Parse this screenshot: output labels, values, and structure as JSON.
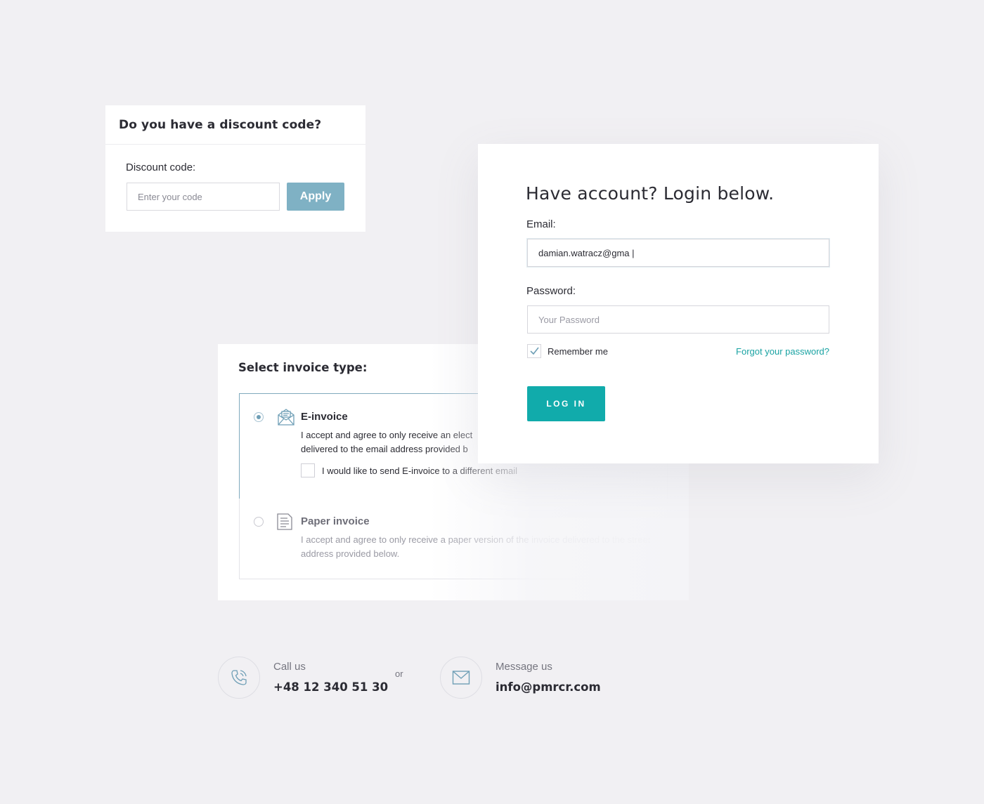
{
  "discount": {
    "title": "Do you have a discount code?",
    "label": "Discount code:",
    "placeholder": "Enter your code",
    "apply_label": "Apply"
  },
  "invoice": {
    "title": "Select invoice type:",
    "options": [
      {
        "name": "E-invoice",
        "description": "I accept and agree to only receive an elect... delivered to the email address provided b...",
        "desc_line1": "I accept and agree to only receive an elect",
        "desc_line2": "delivered to the email address provided b",
        "selected": true,
        "icon": "envelope-open-icon",
        "extra_checkbox_label": "I would like to send E-invoice to a different email"
      },
      {
        "name": "Paper invoice",
        "description": "I accept and agree to only receive a paper version of the invoice delivered to the street address provided below.",
        "selected": false,
        "icon": "document-icon"
      }
    ]
  },
  "login": {
    "title": "Have account? Login below.",
    "email_label": "Email:",
    "email_value": "damian.watracz@gma |",
    "password_label": "Password:",
    "password_placeholder": "Your Password",
    "remember_label": "Remember me",
    "remember_checked": true,
    "forgot_label": "Forgot your password?",
    "login_button": "LOG IN"
  },
  "contact": {
    "call_label": "Call us",
    "call_value": "+48 12 340 51 30",
    "or_label": "or",
    "message_label": "Message us",
    "message_value": "info@pmrcr.com"
  },
  "colors": {
    "background": "#f1f0f3",
    "accent_teal": "#11abab",
    "apply_button": "#7fb1c4",
    "icon_blue": "#6f9fb6"
  }
}
